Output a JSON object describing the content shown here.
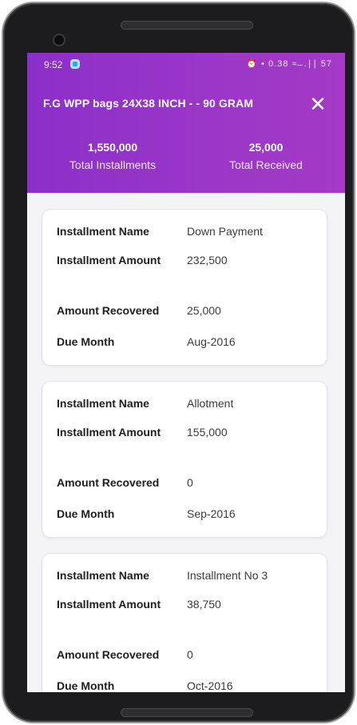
{
  "status": {
    "time": "9:52",
    "icons": "⏰ • 0.38 ≈ ̶ .∣∣ 57"
  },
  "header": {
    "title": "F.G WPP bags 24X38 INCH - - 90 GRAM",
    "close_icon": "✕",
    "totals": [
      {
        "value": "1,550,000",
        "label": "Total Installments"
      },
      {
        "value": "25,000",
        "label": "Total Received"
      }
    ]
  },
  "labels": {
    "installment_name": "Installment Name",
    "installment_amount": "Installment Amount",
    "amount_recovered": "Amount Recovered",
    "due_month": "Due Month"
  },
  "installments": [
    {
      "name": "Down Payment",
      "amount": "232,500",
      "recovered": "25,000",
      "due": "Aug-2016"
    },
    {
      "name": "Allotment",
      "amount": "155,000",
      "recovered": "0",
      "due": "Sep-2016"
    },
    {
      "name": "Installment No 3",
      "amount": "38,750",
      "recovered": "0",
      "due": "Oct-2016"
    }
  ]
}
